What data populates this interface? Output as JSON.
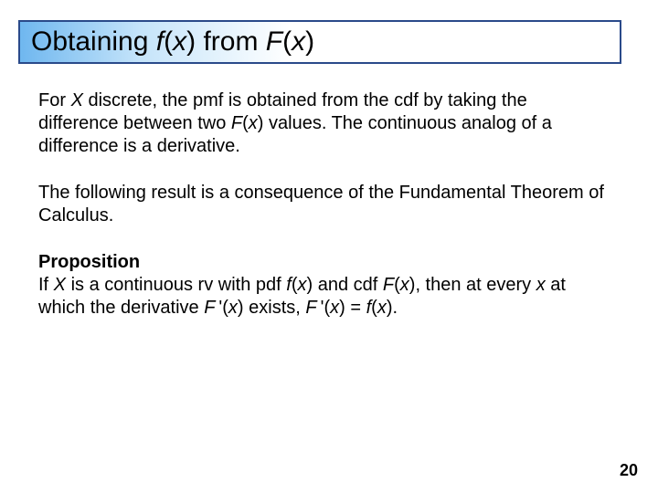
{
  "title": {
    "pre1": "Obtaining ",
    "f": "f",
    "paren_x1_open": "(",
    "x1": "x",
    "paren_x1_close": ")",
    "mid": " from ",
    "F": "F",
    "paren_x2_open": "(",
    "x2": "x",
    "paren_x2_close": ")"
  },
  "para1": {
    "t1": "For ",
    "X": "X",
    "t2": " discrete, the pmf is obtained from the cdf by taking the difference between two ",
    "F": "F",
    "po": "(",
    "x": "x",
    "pc": ")",
    "t3": " values. The continuous analog of a difference is a derivative."
  },
  "para2": "The following result is a consequence of the Fundamental Theorem of Calculus.",
  "prop": {
    "label": "Proposition",
    "t1": "If ",
    "X": "X",
    "t2": " is a continuous rv with pdf ",
    "f1": "f",
    "po1": "(",
    "x1": "x",
    "pc1": ")",
    "t3": " and cdf ",
    "F1": "F",
    "po2": "(",
    "x2": "x",
    "pc2": ")",
    "t4": ", then at every ",
    "x3": "x",
    "t5": " at which the derivative ",
    "F2": "F",
    "prime1": " '",
    "po3": "(",
    "x4": "x",
    "pc3": ")",
    "t6": " exists, ",
    "F3": "F",
    "prime2": " '",
    "po4": "(",
    "x5": "x",
    "pc4": ")",
    "eq": " = ",
    "f2": "f",
    "po5": "(",
    "x6": "x",
    "pc5": ")",
    "period": "."
  },
  "page_number": "20"
}
